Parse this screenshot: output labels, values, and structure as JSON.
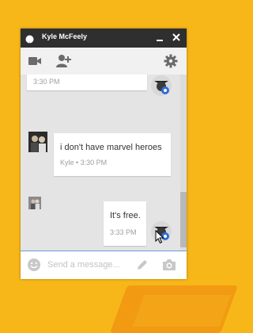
{
  "window": {
    "title": "Kyle McFeely"
  },
  "toolbar": {
    "icons": [
      "video-camera-icon",
      "add-person-icon",
      "gear-icon"
    ]
  },
  "messages": [
    {
      "sender": "me",
      "text": "",
      "time": "3:30 PM"
    },
    {
      "sender": "Kyle",
      "text": "i don't have marvel heroes",
      "time": "Kyle • 3:30 PM"
    },
    {
      "sender": "me",
      "text": "It's free.",
      "time": "3:33 PM"
    }
  ],
  "compose": {
    "placeholder": "Send a message...",
    "value": ""
  },
  "colors": {
    "desktop": "#f7b718",
    "titlebar": "#2f2f2f",
    "chat_bg": "#e4e4e4",
    "accent": "#6a9be3"
  }
}
